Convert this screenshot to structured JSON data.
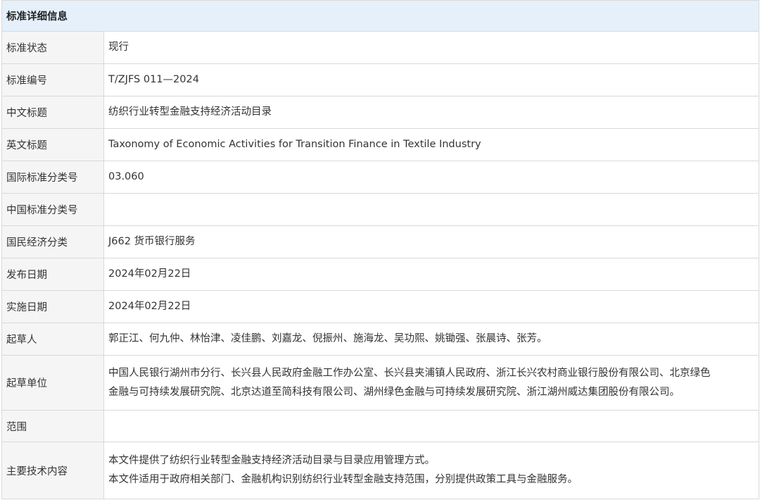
{
  "section": {
    "title": "标准详细信息"
  },
  "rows": [
    {
      "label": "标准状态",
      "value": "现行"
    },
    {
      "label": "标准编号",
      "value": "T/ZJFS 011—2024"
    },
    {
      "label": "中文标题",
      "value": "纺织行业转型金融支持经济活动目录"
    },
    {
      "label": "英文标题",
      "value": "Taxonomy of Economic Activities for Transition Finance in Textile Industry"
    },
    {
      "label": "国际标准分类号",
      "value": "03.060"
    },
    {
      "label": "中国标准分类号",
      "value": ""
    },
    {
      "label": "国民经济分类",
      "value": "J662 货币银行服务"
    },
    {
      "label": "发布日期",
      "value": "2024年02月22日"
    },
    {
      "label": "实施日期",
      "value": "2024年02月22日"
    },
    {
      "label": "起草人",
      "value": "郭正江、何九仲、林怡津、凌佳鹏、刘嘉龙、倪振州、施海龙、吴功熙、姚锄强、张晨诗、张芳。"
    },
    {
      "label": "起草单位",
      "lines": [
        "中国人民银行湖州市分行、长兴县人民政府金融工作办公室、长兴县夹浦镇人民政府、浙江长兴农村商业银行股份有限公司、北京绿色",
        "金融与可持续发展研究院、北京达道至简科技有限公司、湖州绿色金融与可持续发展研究院、浙江湖州威达集团股份有限公司。"
      ]
    },
    {
      "label": "范围",
      "value": ""
    },
    {
      "label": "主要技术内容",
      "lines": [
        "本文件提供了纺织行业转型金融支持经济活动目录与目录应用管理方式。",
        "本文件适用于政府相关部门、金融机构识别纺织行业转型金融支持范围，分别提供政策工具与金融服务。"
      ]
    }
  ]
}
